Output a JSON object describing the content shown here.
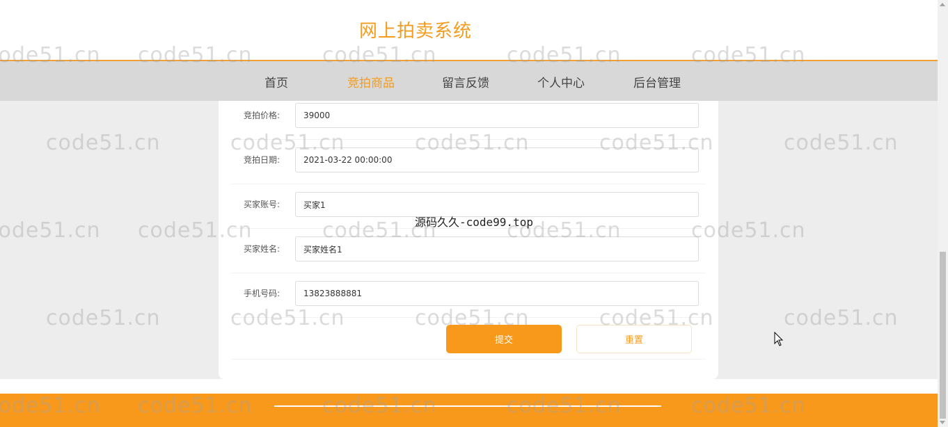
{
  "header": {
    "site_title": "网上拍卖系统"
  },
  "nav": {
    "items": [
      {
        "label": "首页",
        "active": false
      },
      {
        "label": "竞拍商品",
        "active": true
      },
      {
        "label": "留言反馈",
        "active": false
      },
      {
        "label": "个人中心",
        "active": false
      },
      {
        "label": "后台管理",
        "active": false
      }
    ]
  },
  "form": {
    "fields": [
      {
        "label": "竞拍价格:",
        "value": "39000"
      },
      {
        "label": "竞拍日期:",
        "value": "2021-03-22 00:00:00"
      },
      {
        "label": "买家账号:",
        "value": "买家1"
      },
      {
        "label": "买家姓名:",
        "value": "买家姓名1"
      },
      {
        "label": "手机号码:",
        "value": "13823888881"
      }
    ],
    "submit_label": "提交",
    "reset_label": "重置"
  },
  "watermark": {
    "text": "code51.cn",
    "center_text": "源码久久-code99.top"
  },
  "colors": {
    "accent": "#f8991c",
    "nav_bg": "#d8d8d8",
    "page_bg": "#ededed"
  }
}
